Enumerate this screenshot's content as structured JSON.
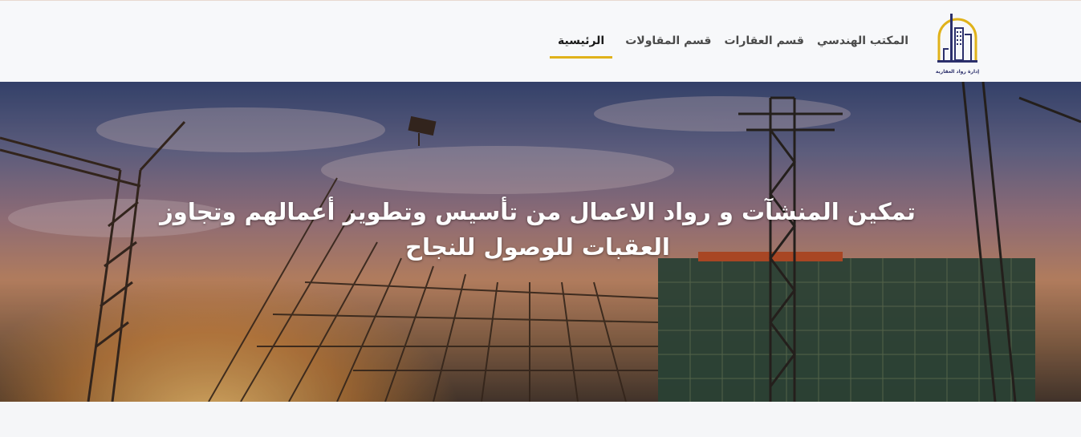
{
  "header": {
    "logo_text": "إدارة رواد العقارية",
    "nav": [
      {
        "label": "الرئيسية",
        "active": true
      },
      {
        "label": "قسم المقاولات",
        "active": false
      },
      {
        "label": "قسم العقارات",
        "active": false
      },
      {
        "label": "المكتب الهندسي",
        "active": false
      }
    ]
  },
  "hero": {
    "title_line1": "تمكين المنشآت و رواد الاعمال من تأسيس وتطوير أعمالهم وتجاوز",
    "title_line2": "العقبات للوصول للنجاح"
  },
  "colors": {
    "accent": "#e0b21a",
    "logo_navy": "#2b2f6b",
    "nav_text": "#4a4a4a"
  }
}
